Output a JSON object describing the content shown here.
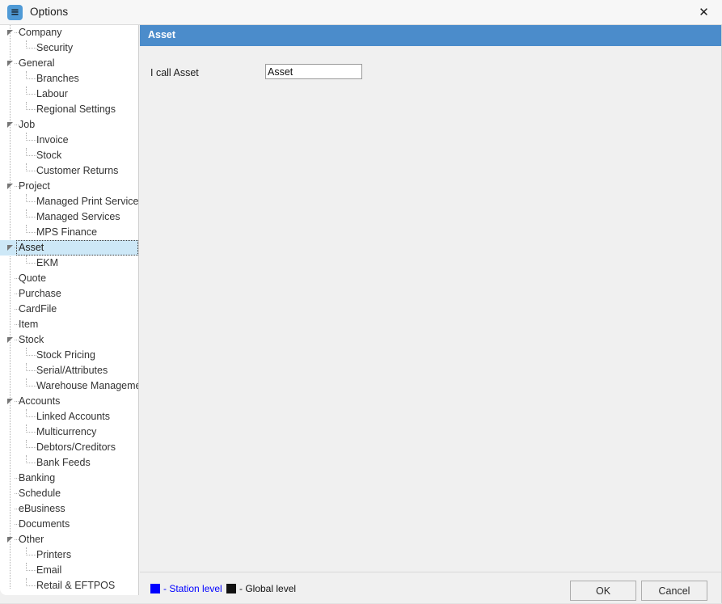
{
  "window": {
    "title": "Options",
    "icon": "options-app-icon",
    "close_icon": "✕"
  },
  "sidebar": {
    "items": [
      {
        "label": "Company",
        "depth": 0,
        "expandable": true,
        "selected": false
      },
      {
        "label": "Security",
        "depth": 1,
        "expandable": false,
        "selected": false
      },
      {
        "label": "General",
        "depth": 0,
        "expandable": true,
        "selected": false
      },
      {
        "label": "Branches",
        "depth": 1,
        "expandable": false,
        "selected": false
      },
      {
        "label": "Labour",
        "depth": 1,
        "expandable": false,
        "selected": false
      },
      {
        "label": "Regional Settings",
        "depth": 1,
        "expandable": false,
        "selected": false
      },
      {
        "label": "Job",
        "depth": 0,
        "expandable": true,
        "selected": false
      },
      {
        "label": "Invoice",
        "depth": 1,
        "expandable": false,
        "selected": false
      },
      {
        "label": "Stock",
        "depth": 1,
        "expandable": false,
        "selected": false
      },
      {
        "label": "Customer Returns",
        "depth": 1,
        "expandable": false,
        "selected": false
      },
      {
        "label": "Project",
        "depth": 0,
        "expandable": true,
        "selected": false
      },
      {
        "label": "Managed Print Services",
        "depth": 1,
        "expandable": false,
        "selected": false
      },
      {
        "label": "Managed Services",
        "depth": 1,
        "expandable": false,
        "selected": false
      },
      {
        "label": "MPS Finance",
        "depth": 1,
        "expandable": false,
        "selected": false
      },
      {
        "label": "Asset",
        "depth": 0,
        "expandable": true,
        "selected": true
      },
      {
        "label": "EKM",
        "depth": 1,
        "expandable": false,
        "selected": false
      },
      {
        "label": "Quote",
        "depth": 0,
        "expandable": false,
        "selected": false
      },
      {
        "label": "Purchase",
        "depth": 0,
        "expandable": false,
        "selected": false
      },
      {
        "label": "CardFile",
        "depth": 0,
        "expandable": false,
        "selected": false
      },
      {
        "label": "Item",
        "depth": 0,
        "expandable": false,
        "selected": false
      },
      {
        "label": "Stock",
        "depth": 0,
        "expandable": true,
        "selected": false
      },
      {
        "label": "Stock Pricing",
        "depth": 1,
        "expandable": false,
        "selected": false
      },
      {
        "label": "Serial/Attributes",
        "depth": 1,
        "expandable": false,
        "selected": false
      },
      {
        "label": "Warehouse Management",
        "depth": 1,
        "expandable": false,
        "selected": false
      },
      {
        "label": "Accounts",
        "depth": 0,
        "expandable": true,
        "selected": false
      },
      {
        "label": "Linked Accounts",
        "depth": 1,
        "expandable": false,
        "selected": false
      },
      {
        "label": "Multicurrency",
        "depth": 1,
        "expandable": false,
        "selected": false
      },
      {
        "label": "Debtors/Creditors",
        "depth": 1,
        "expandable": false,
        "selected": false
      },
      {
        "label": "Bank Feeds",
        "depth": 1,
        "expandable": false,
        "selected": false
      },
      {
        "label": "Banking",
        "depth": 0,
        "expandable": false,
        "selected": false
      },
      {
        "label": "Schedule",
        "depth": 0,
        "expandable": false,
        "selected": false
      },
      {
        "label": "eBusiness",
        "depth": 0,
        "expandable": false,
        "selected": false
      },
      {
        "label": "Documents",
        "depth": 0,
        "expandable": false,
        "selected": false
      },
      {
        "label": "Other",
        "depth": 0,
        "expandable": true,
        "selected": false
      },
      {
        "label": "Printers",
        "depth": 1,
        "expandable": false,
        "selected": false
      },
      {
        "label": "Email",
        "depth": 1,
        "expandable": false,
        "selected": false
      },
      {
        "label": "Retail & EFTPOS",
        "depth": 1,
        "expandable": false,
        "selected": false
      }
    ]
  },
  "content": {
    "banner_title": "Asset",
    "field_label": "I call Asset",
    "field_value": "Asset",
    "field_placeholder": ""
  },
  "footer": {
    "legend_station": "- Station level",
    "legend_global": "- Global level",
    "ok_label": "OK",
    "cancel_label": "Cancel"
  },
  "colors": {
    "banner_blue": "#4b8ccb",
    "selection_blue": "#cde8f7",
    "station_level": "#0000ff",
    "global_level": "#111111",
    "app_icon_blue": "#4f9ad6"
  }
}
